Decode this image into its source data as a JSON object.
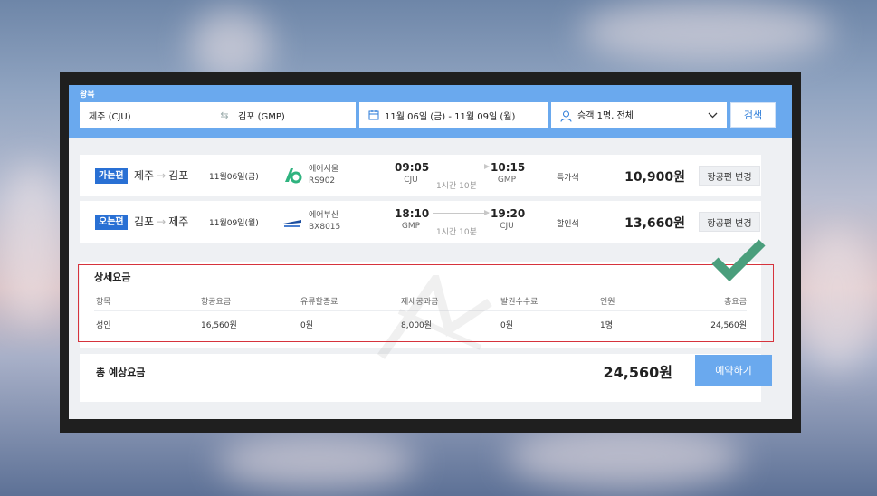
{
  "search": {
    "trip_type_label": "왕복",
    "from": "제주 (CJU)",
    "to": "김포 (GMP)",
    "dates": "11월 06일 (금) - 11월 09일 (월)",
    "passengers": "승객 1명, 전체",
    "search_button": "검색"
  },
  "flights": [
    {
      "tag": "가는편",
      "from_city": "제주",
      "to_city": "김포",
      "date": "11월06일(금)",
      "airline": "에어서울",
      "flight_no": "RS902",
      "dep_time": "09:05",
      "dep_airport": "CJU",
      "duration": "1시간 10분",
      "arr_time": "10:15",
      "arr_airport": "GMP",
      "seat_class": "특가석",
      "price": "10,900원",
      "change_button": "항공편 변경",
      "logo_icon": "air-seoul-logo-icon",
      "logo_color": "#2fb37f"
    },
    {
      "tag": "오는편",
      "from_city": "김포",
      "to_city": "제주",
      "date": "11월09일(월)",
      "airline": "에어부산",
      "flight_no": "BX8015",
      "dep_time": "18:10",
      "dep_airport": "GMP",
      "duration": "1시간 10분",
      "arr_time": "19:20",
      "arr_airport": "CJU",
      "seat_class": "할인석",
      "price": "13,660원",
      "change_button": "항공편 변경",
      "logo_icon": "air-busan-logo-icon",
      "logo_color": "#1d4fa0"
    }
  ],
  "fare_detail": {
    "title": "상세요금",
    "headers": [
      "항목",
      "항공요금",
      "유류할증료",
      "제세공과금",
      "발권수수료",
      "인원",
      "총요금"
    ],
    "rows": [
      [
        "성인",
        "16,560원",
        "0원",
        "8,000원",
        "0원",
        "1명",
        "24,560원"
      ]
    ]
  },
  "total": {
    "label": "총 예상요금",
    "price": "24,560원",
    "book_button": "예약하기"
  },
  "colors": {
    "accent": "#6aa9ee",
    "tag_blue": "#2970d4",
    "highlight_red": "#d6333c",
    "check_green": "#4a9e7c"
  }
}
